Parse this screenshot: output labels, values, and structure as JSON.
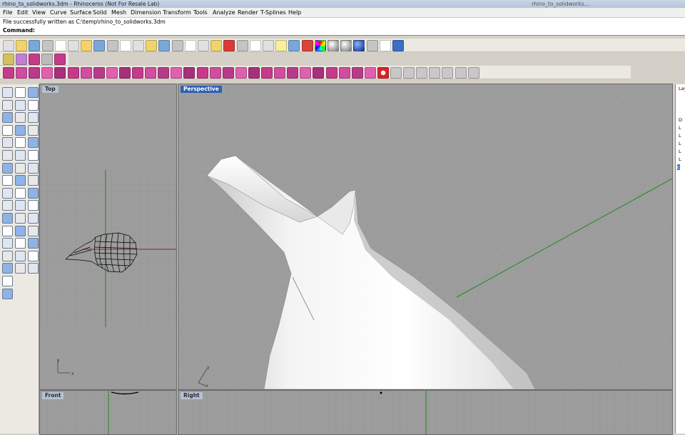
{
  "window": {
    "title": "rhino_to_solidworks.3dm - Rhinoceros (Not For Resale Lab)",
    "taskbar_title": "rhino_to_solidworks..."
  },
  "menu": [
    "File",
    "Edit",
    "View",
    "Curve",
    "Surface",
    "Solid",
    "Mesh",
    "Dimension",
    "Transform",
    "Tools",
    "Analyze",
    "Render",
    "T-Splines",
    "Help"
  ],
  "command": {
    "history": "File successfully written as C:\\temp\\rhino_to_solidworks.3dm",
    "prompt_label": "Command:",
    "value": ""
  },
  "viewports": {
    "top": "Top",
    "perspective": "Perspective",
    "front": "Front",
    "right": "Right"
  },
  "axis_labels": {
    "x": "x",
    "y": "y"
  },
  "layers_panel": {
    "header": "Lay",
    "items": [
      "D",
      "L",
      "L",
      "L",
      "L",
      "L",
      "c"
    ]
  },
  "colors": {
    "viewport_bg": "#9d9d9d",
    "active_label": "#2f5fb3",
    "x_axis": "#b02020",
    "y_axis": "#1f8a1f",
    "grid": "#8f8f8f"
  },
  "toolbar_icons": {
    "row1": [
      "new-icon",
      "open-icon",
      "save-icon",
      "print-icon",
      "import-icon",
      "cut-icon",
      "copy-icon",
      "paste-icon",
      "undo-icon",
      "pan-icon",
      "move-view-icon",
      "zoom-icon",
      "zoom-window-icon",
      "zoom-extents-icon",
      "zoom-selected-icon",
      "rotate-view-icon",
      "four-view-icon",
      "car-icon",
      "wire-icon",
      "eye-icon",
      "select-icon",
      "lightbulb-icon",
      "lock-icon",
      "layer-icon",
      "color-wheel-icon",
      "sphere-shade-icon",
      "render-sphere-icon",
      "blue-sphere-icon",
      "options-icon",
      "tool-icon",
      "help-icon"
    ],
    "row2": [
      "point-snap-icon",
      "star-icon",
      "polygon-icon",
      "dome-icon",
      "pink-gear-icon"
    ],
    "row3": [
      "tsplines-box-icon",
      "tsplines-sphere-icon",
      "tsplines-cylinder-icon",
      "tsplines-plane-icon",
      "tsplines-face-icon",
      "tsplines-extrude-icon",
      "tsplines-weld-icon",
      "tsplines-crease-icon",
      "tsplines-smooth-icon",
      "tsplines-append-icon",
      "tsplines-subdivide-icon",
      "tsplines-insert-icon",
      "tsplines-bridge-icon",
      "tsplines-fill-icon",
      "tsplines-mirror-icon",
      "tsplines-symmetry-icon",
      "tsplines-thicken-icon",
      "tsplines-pipe-icon",
      "tsplines-loft-icon",
      "tsplines-rail-icon",
      "tsplines-match-icon",
      "tsplines-convert-icon",
      "tsplines-uv-icon",
      "tsplines-select-icon",
      "tsplines-grow-icon",
      "tsplines-gumball-icon",
      "tsplines-vertex-icon",
      "tsplines-edge-icon",
      "tsplines-mode-icon",
      "stop-icon",
      "manipulator-icon",
      "translate-icon",
      "scale-icon",
      "rotate-icon",
      "frame-icon",
      "up-arrow-icon",
      "gear-icon"
    ]
  }
}
